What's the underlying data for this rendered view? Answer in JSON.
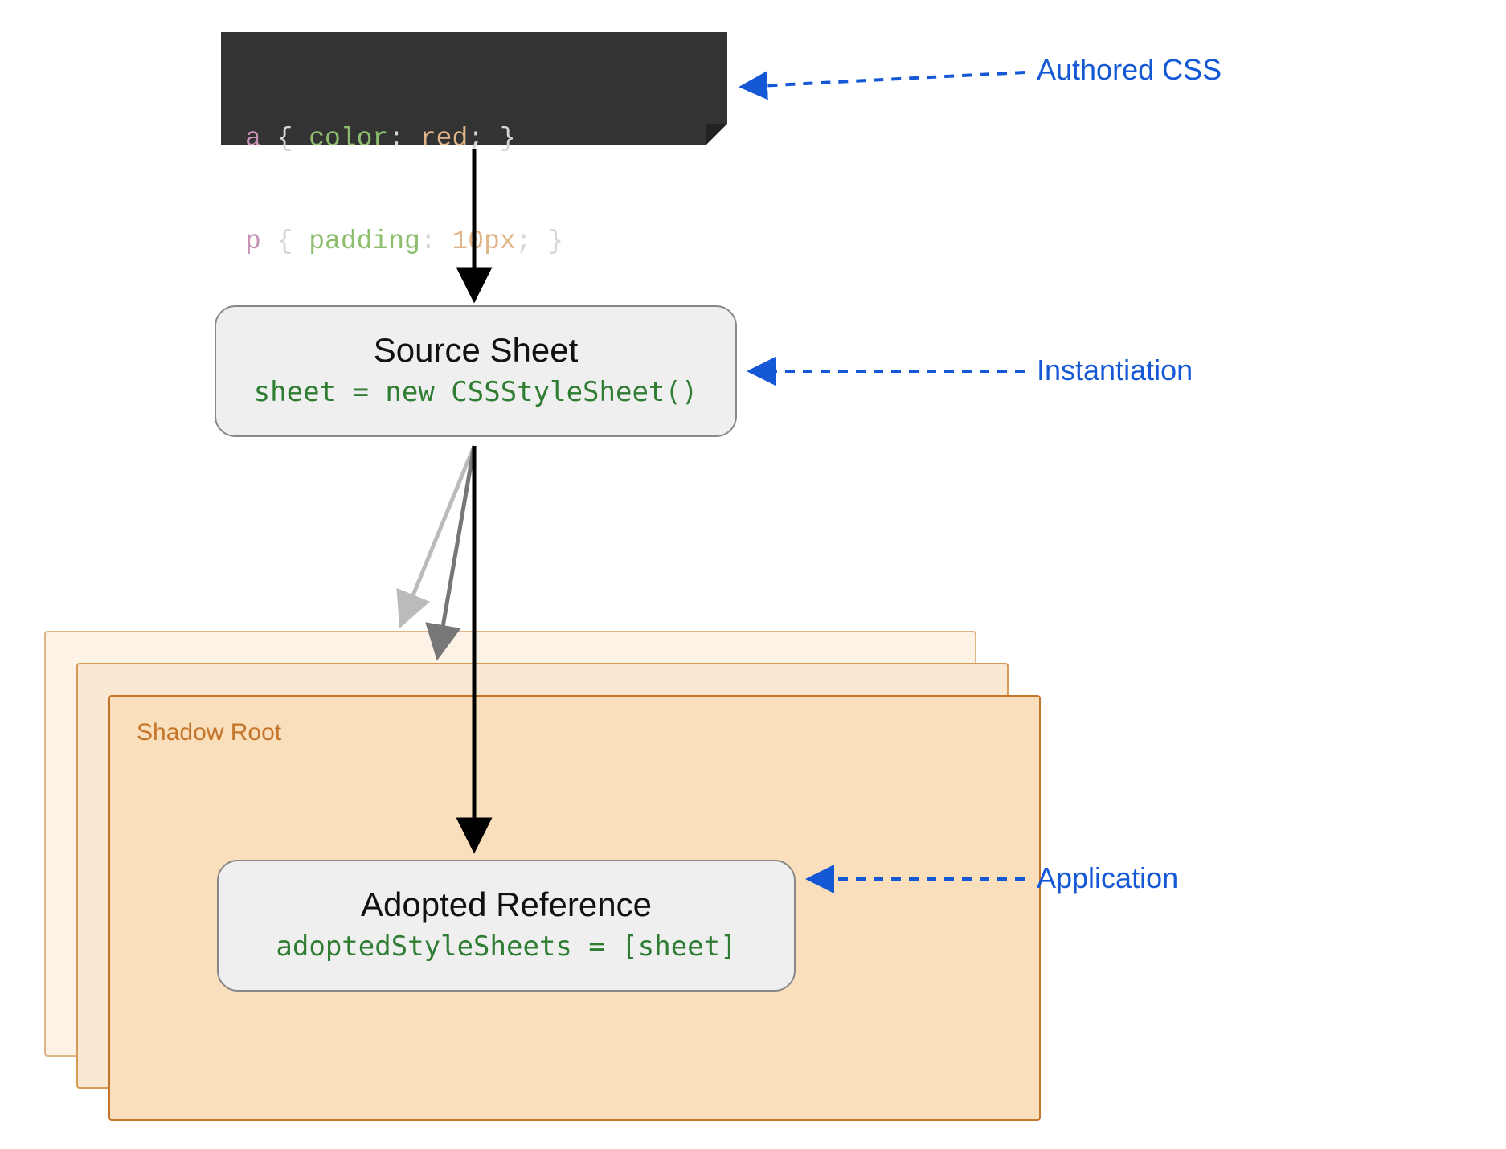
{
  "code": {
    "line1": {
      "sel": "a",
      "brace_open": " { ",
      "prop": "color",
      "colon": ": ",
      "val": "red",
      "end": "; }"
    },
    "line2": {
      "sel": "p",
      "brace_open": " { ",
      "prop": "padding",
      "colon": ": ",
      "val": "10px",
      "end": "; }"
    }
  },
  "source": {
    "title": "Source Sheet",
    "code": "sheet = new CSSStyleSheet()"
  },
  "shadow_root_label": "Shadow Root",
  "adopted": {
    "title": "Adopted Reference",
    "code": "adoptedStyleSheets = [sheet]"
  },
  "annotations": {
    "authored_css": "Authored CSS",
    "instantiation": "Instantiation",
    "application": "Application"
  }
}
